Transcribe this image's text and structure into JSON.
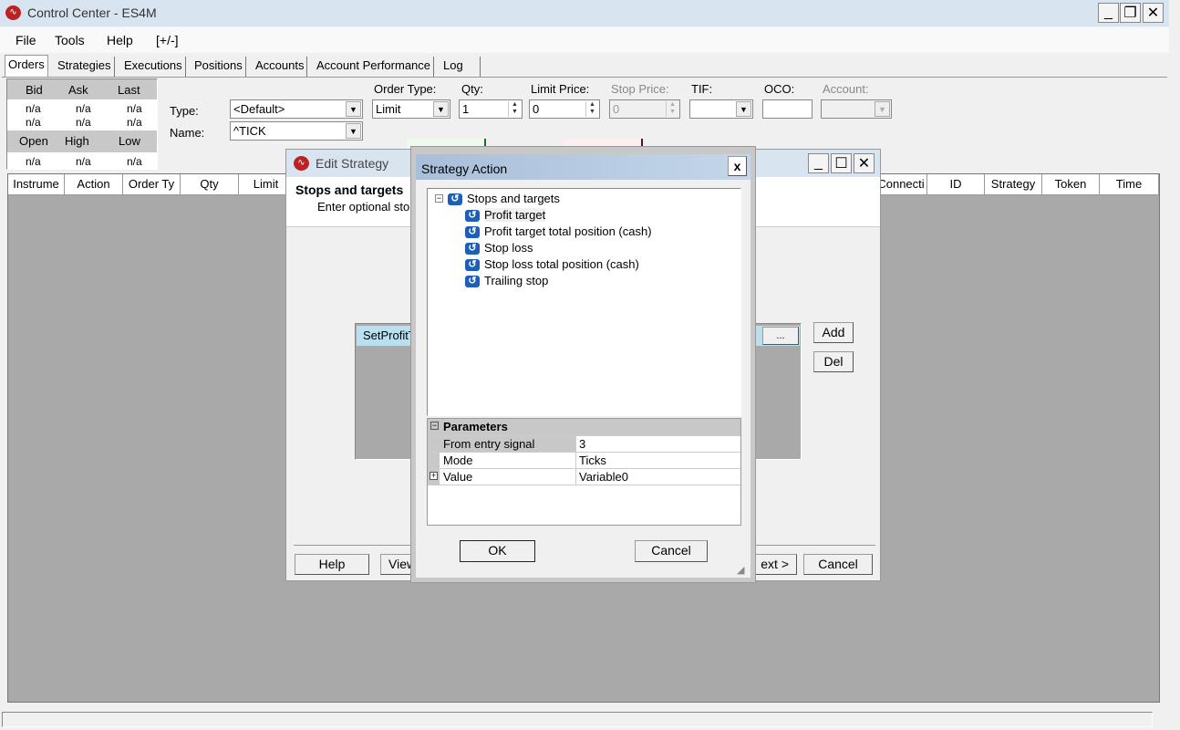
{
  "window": {
    "title": "Control Center - ES4M"
  },
  "menu": [
    "File",
    "Tools",
    "Help",
    "[+/-]"
  ],
  "tabs": [
    "Orders",
    "Strategies",
    "Executions",
    "Positions",
    "Accounts",
    "Account Performance",
    "Log"
  ],
  "quote": {
    "headers1": [
      "Bid",
      "Ask",
      "Last"
    ],
    "rows1": [
      [
        "n/a",
        "n/a",
        "n/a"
      ],
      [
        "n/a",
        "n/a",
        "n/a"
      ]
    ],
    "headers2": [
      "Open",
      "High",
      "Low"
    ],
    "rows2": [
      [
        "n/a",
        "n/a",
        "n/a"
      ]
    ]
  },
  "order_entry": {
    "type_label": "Type:",
    "type_value": "<Default>",
    "name_label": "Name:",
    "name_value": "^TICK",
    "order_type_label": "Order Type:",
    "order_type_value": "Limit",
    "qty_label": "Qty:",
    "qty_value": "1",
    "limit_label": "Limit Price:",
    "limit_value": "0",
    "stop_label": "Stop Price:",
    "stop_value": "0",
    "tif_label": "TIF:",
    "tif_value": "",
    "oco_label": "OCO:",
    "oco_value": "",
    "account_label": "Account:",
    "account_value": ""
  },
  "orders_columns_left": [
    "Instrume",
    "Action",
    "Order Ty",
    "Qty",
    "Limit"
  ],
  "orders_columns_right": [
    "Connecti",
    "ID",
    "Strategy",
    "Token",
    "Time"
  ],
  "edit_strategy": {
    "title": "Edit Strategy",
    "heading": "Stops and targets",
    "subheading": "Enter optional sto",
    "grid_row": "SetProfitT",
    "ellipsis": "...",
    "add": "Add",
    "del": "Del",
    "help": "Help",
    "view": "View",
    "next": "ext >",
    "cancel": "Cancel"
  },
  "strategy_action": {
    "title": "Strategy Action",
    "close": "x",
    "tree_root": "Stops and targets",
    "tree_items": [
      "Profit target",
      "Profit target total position (cash)",
      "Stop loss",
      "Stop loss total position (cash)",
      "Trailing stop"
    ],
    "params_header": "Parameters",
    "params": [
      {
        "name": "From entry signal",
        "value": "3"
      },
      {
        "name": "Mode",
        "value": "Ticks"
      },
      {
        "name": "Value",
        "value": "Variable0"
      }
    ],
    "ok": "OK",
    "cancel": "Cancel"
  }
}
